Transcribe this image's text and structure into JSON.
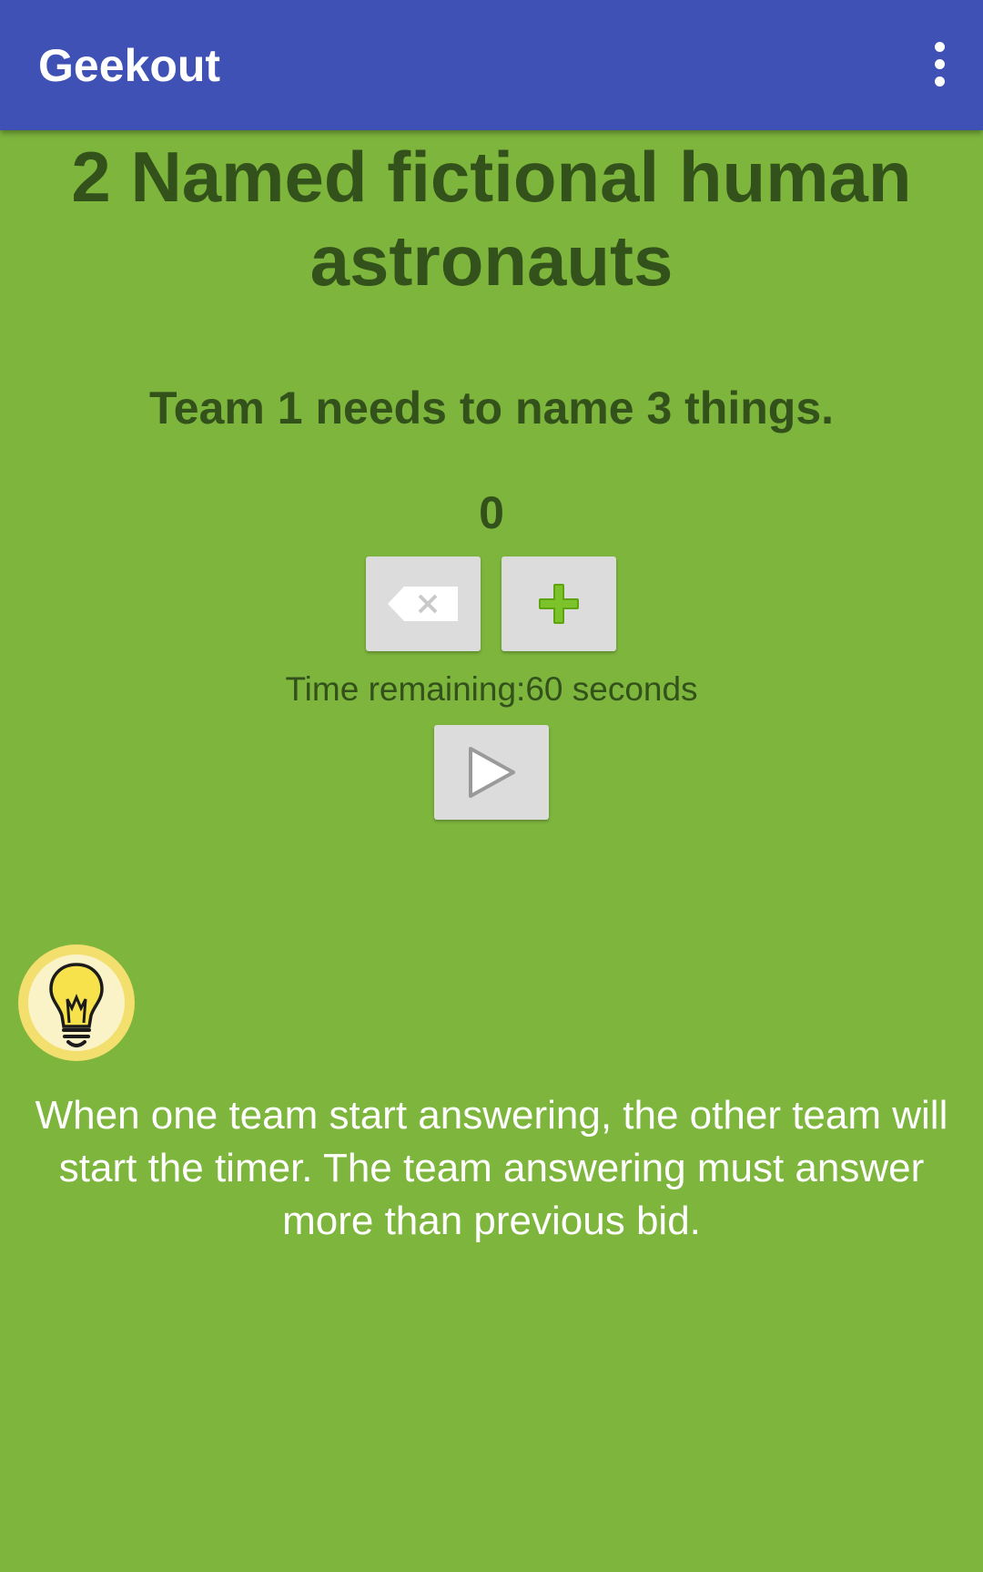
{
  "app_bar": {
    "title": "Geekout",
    "menu_icon": "more-vert-icon"
  },
  "main": {
    "category": "2 Named fictional human astronauts",
    "instruction": "Team 1 needs to name 3 things.",
    "count": "0",
    "timer_text": "Time remaining:60 seconds",
    "tip_icon": "lightbulb-icon",
    "tip_text": "When one team start answering, the other team will start the timer. The team answering must answer more than previous bid."
  },
  "colors": {
    "app_bar": "#3f51b5",
    "background": "#7db53d",
    "text_dark_green": "#33511a",
    "button_gray": "#dcdcdc",
    "plus_green": "#5ea40f"
  }
}
